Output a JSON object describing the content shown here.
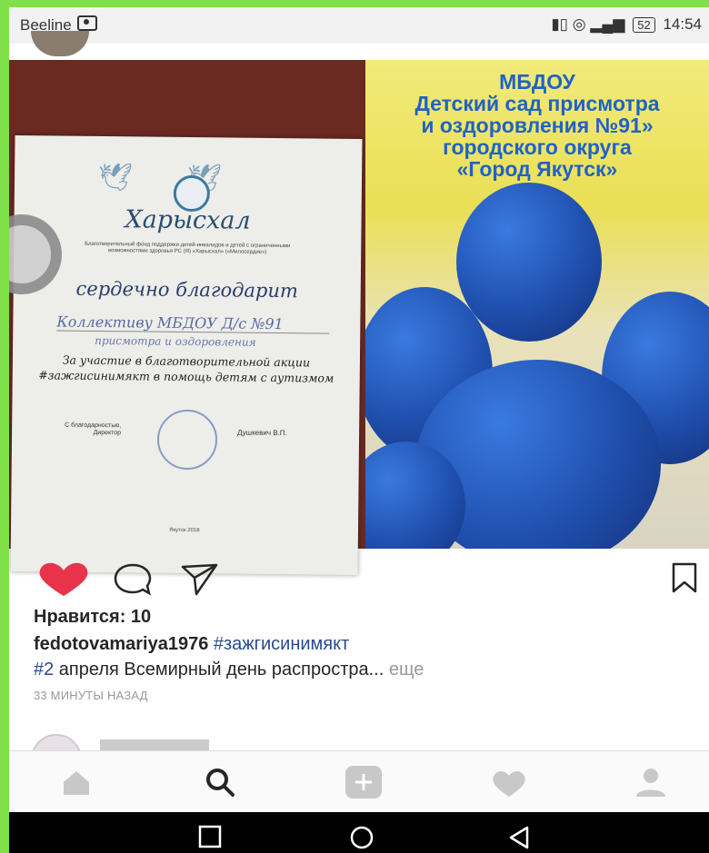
{
  "status_bar": {
    "carrier": "Beeline",
    "battery": "52",
    "time": "14:54"
  },
  "certificate": {
    "title": "Харысхал",
    "small_text": "Благотворительный фонд поддержки детей-инвалидов и детей с ограниченными возможностями здоровья РС (Я) «Харысхал» («Милосердие»)",
    "thanks": "сердечно благодарит",
    "recipient_line1": "Коллективу МБДОУ Д/с №91",
    "recipient_line2": "присмотра и оздоровления",
    "participation_line1": "За участие в благотворительной акции",
    "participation_line2": "#зажгисинимякт в помощь детям с аутизмом",
    "sign_left_line1": "С благодарностью,",
    "sign_left_line2": "Директор",
    "sign_right": "Душкевич В.П.",
    "city": "Якутск 2018"
  },
  "banner": {
    "line1": "МБДОУ",
    "line2": "Детский сад присмотра",
    "line3": "и оздоровления №91»",
    "line4": "городского округа",
    "line5": "«Город Якутск»"
  },
  "post": {
    "likes": "Нравится: 10",
    "username": "fedotovamariya1976",
    "hashtag": "#зажгисинимякт",
    "caption_tag": "#2",
    "caption_text": " апреля Всемирный день распростра...",
    "more": " еще",
    "time_ago": "33 МИНУТЫ НАЗАД"
  },
  "colors": {
    "heart": "#e8344a",
    "hashtag": "#2a4a8c",
    "banner_text": "#1f63c6",
    "balloon": "#1f4fae"
  }
}
